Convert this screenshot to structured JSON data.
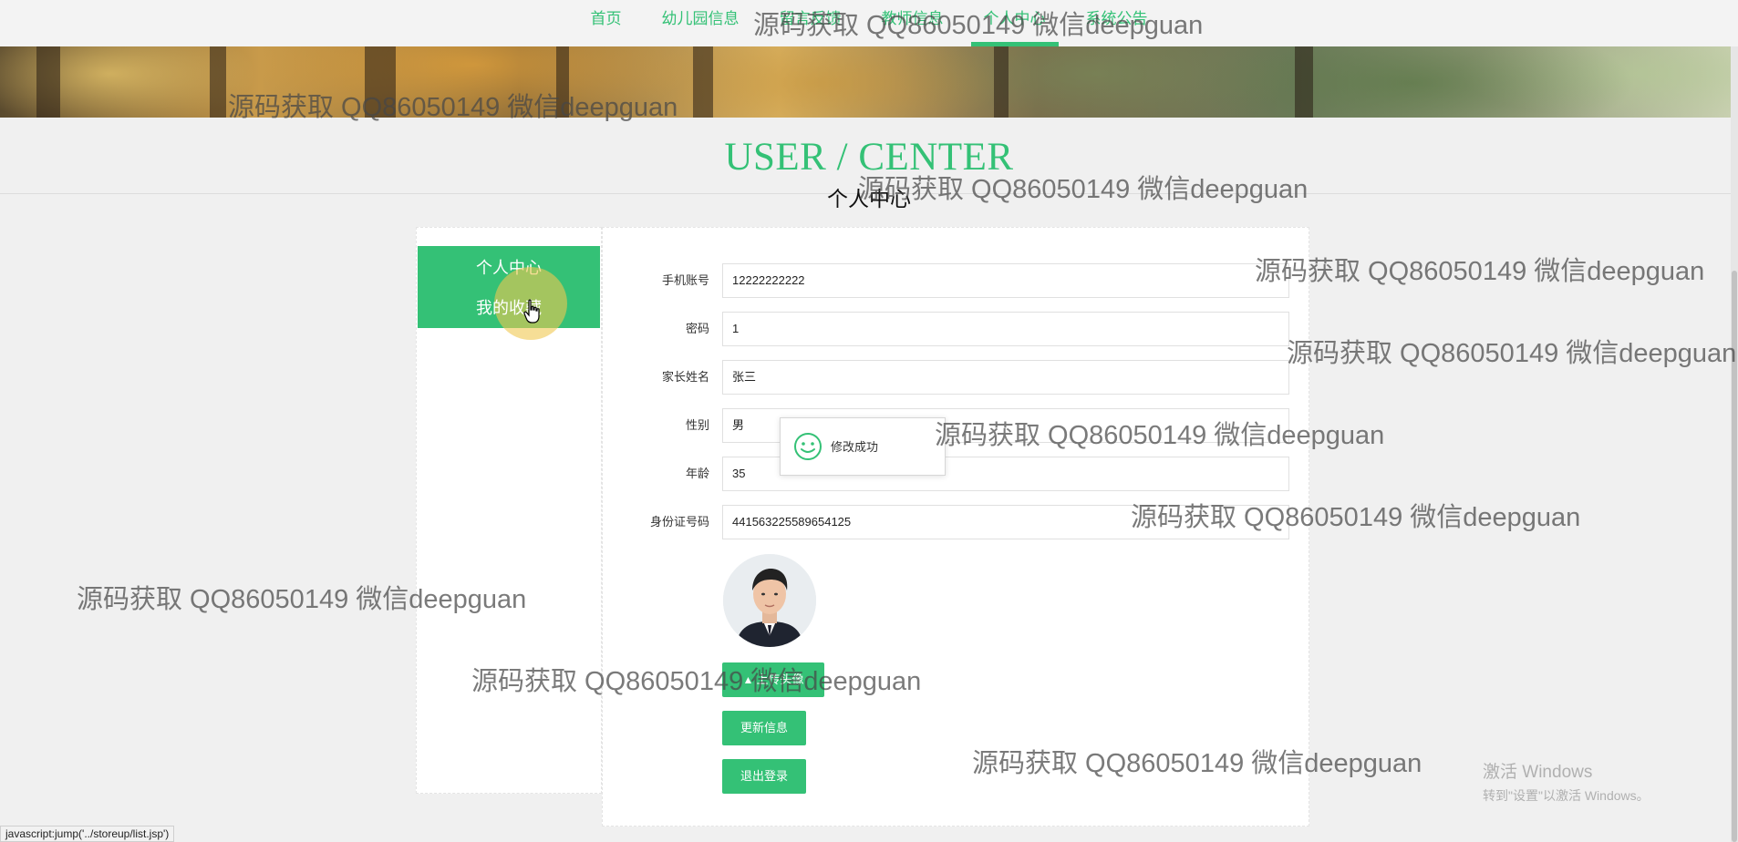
{
  "nav": {
    "items": [
      "首页",
      "幼儿园信息",
      "留言反馈",
      "教师信息",
      "个人中心",
      "系统公告"
    ],
    "active_index": 4
  },
  "page": {
    "title_en": "USER / CENTER",
    "title_cn": "个人中心"
  },
  "side_menu": {
    "items": [
      "个人中心",
      "我的收藏"
    ]
  },
  "form": {
    "fields": [
      {
        "label": "手机账号",
        "value": "12222222222"
      },
      {
        "label": "密码",
        "value": "1"
      },
      {
        "label": "家长姓名",
        "value": "张三"
      },
      {
        "label": "性别",
        "value": "男"
      },
      {
        "label": "年龄",
        "value": "35"
      },
      {
        "label": "身份证号码",
        "value": "441563225589654125"
      }
    ],
    "upload_label": "上传头像",
    "update_label": "更新信息",
    "logout_label": "退出登录"
  },
  "toast": {
    "message": "修改成功"
  },
  "watermark": "源码获取 QQ86050149 微信deepguan",
  "windows_activation": {
    "line1": "激活 Windows",
    "line2": "转到\"设置\"以激活 Windows。"
  },
  "status_bar": "javascript:jump('../storeup/list.jsp')",
  "colors": {
    "accent": "#34c176"
  }
}
